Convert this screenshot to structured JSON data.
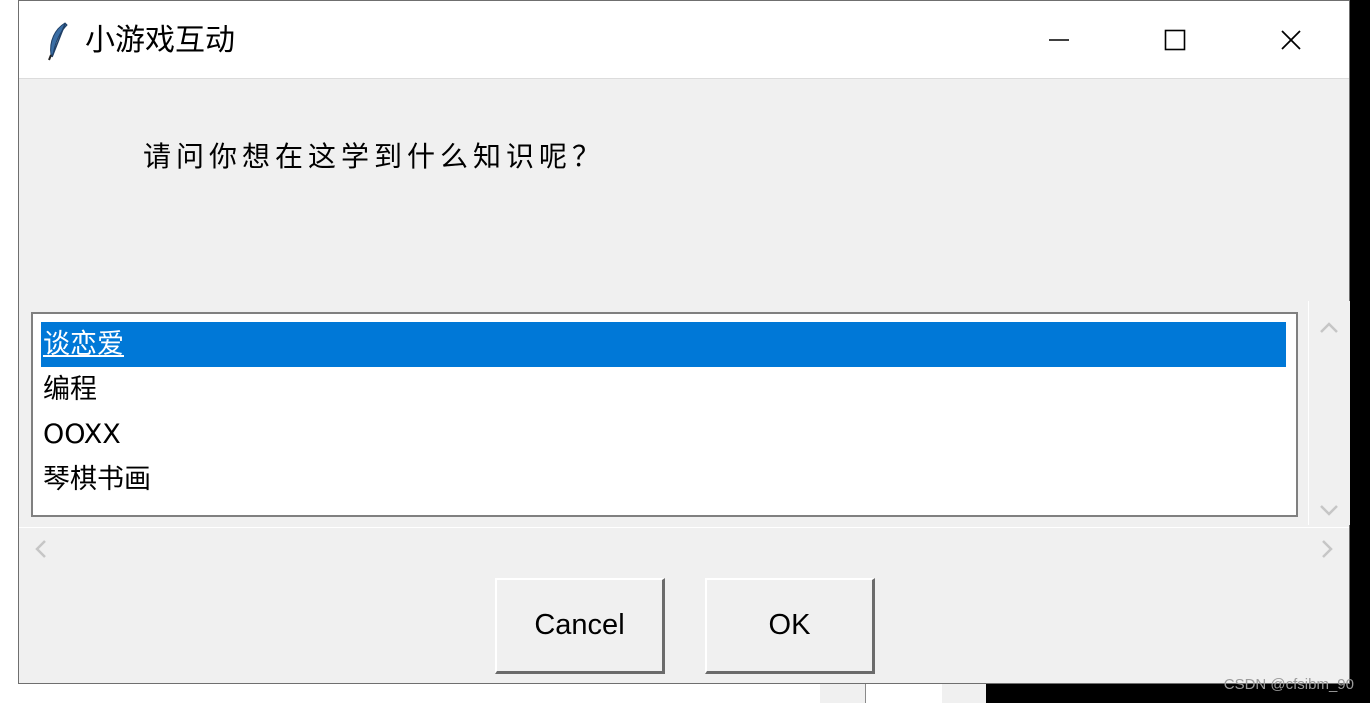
{
  "window": {
    "title": "小游戏互动",
    "icons": {
      "app": "feather-icon",
      "minimize": "minimize-icon",
      "maximize": "maximize-icon",
      "close": "close-icon"
    }
  },
  "dialog": {
    "prompt": "请问你想在这学到什么知识呢？",
    "list": {
      "items": [
        "谈恋爱",
        "编程",
        "OOXX",
        "琴棋书画"
      ],
      "selected_index": 0
    },
    "buttons": {
      "cancel": "Cancel",
      "ok": "OK"
    }
  },
  "watermark": "CSDN @cfsibm_90",
  "colors": {
    "selection": "#0078d7",
    "window_bg": "#f0f0f0",
    "titlebar_bg": "#ffffff"
  }
}
